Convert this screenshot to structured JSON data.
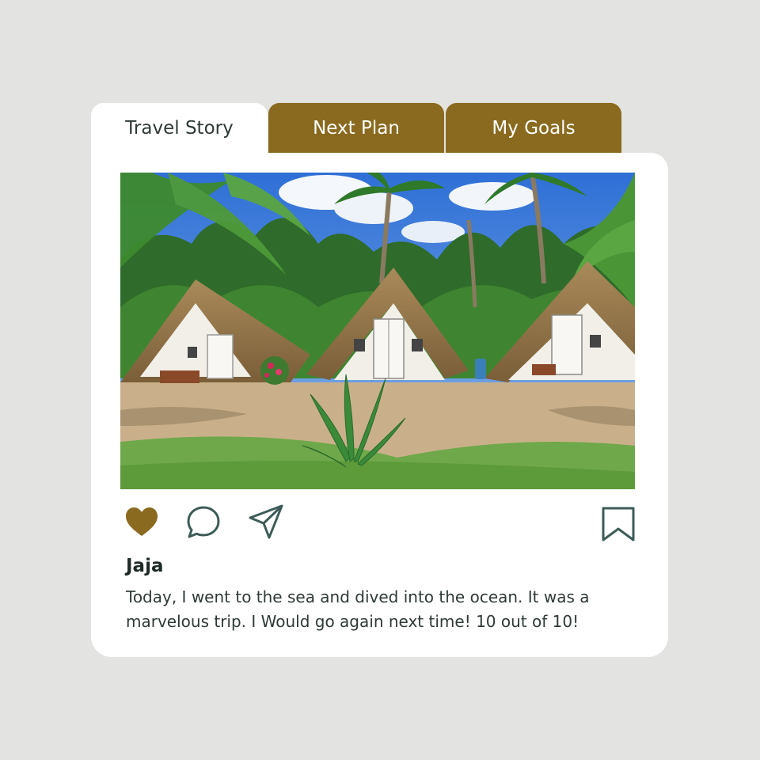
{
  "tabs": [
    {
      "label": "Travel Story",
      "active": true
    },
    {
      "label": "Next Plan",
      "active": false
    },
    {
      "label": "My Goals",
      "active": false
    }
  ],
  "post": {
    "photo_icon": "photo-beach-huts",
    "username": "Jaja",
    "caption": "Today, I went to the sea and dived into the ocean. It was a marvelous trip. I Would go again next time! 10 out of 10!",
    "liked": true
  },
  "actions": {
    "like_icon": "heart-icon",
    "comment_icon": "comment-icon",
    "share_icon": "send-icon",
    "save_icon": "bookmark-icon"
  },
  "colors": {
    "background": "#e3e3e1",
    "card": "#ffffff",
    "accent_gold": "#8a6a1f",
    "icon_teal": "#3d5c58",
    "text_dark": "#2f3a36"
  }
}
